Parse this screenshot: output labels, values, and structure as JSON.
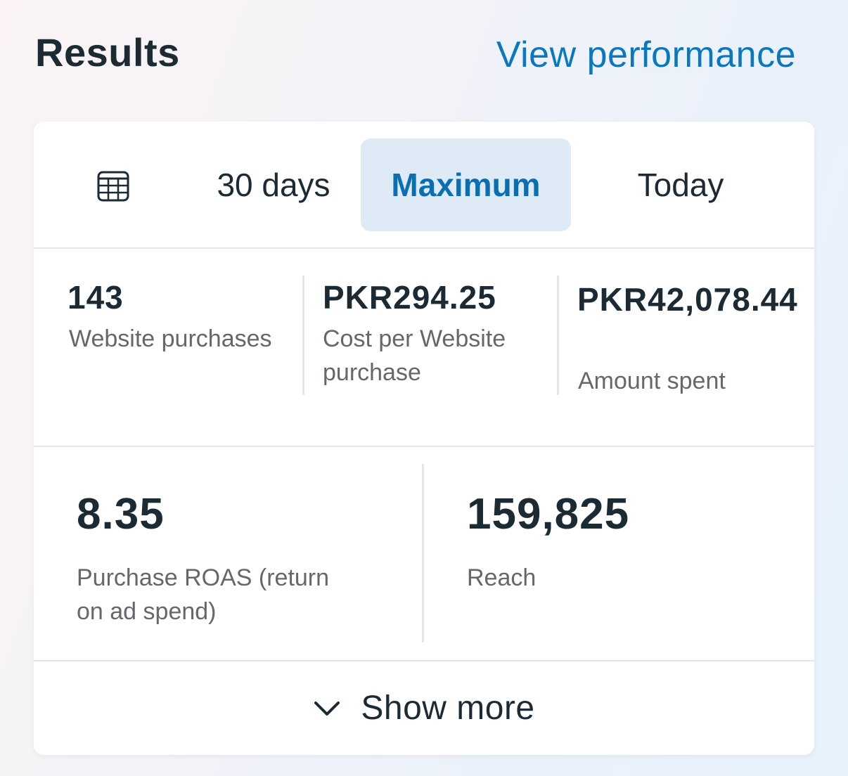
{
  "header": {
    "title": "Results",
    "link_label": "View performance"
  },
  "tabs": {
    "calendar_icon": "calendar-icon",
    "items": [
      {
        "label": "30 days",
        "selected": false
      },
      {
        "label": "Maximum",
        "selected": true
      },
      {
        "label": "Today",
        "selected": false
      }
    ]
  },
  "metrics": {
    "row1": [
      {
        "value": "143",
        "label": "Website purchases"
      },
      {
        "value": "PKR294.25",
        "label": "Cost per Website purchase"
      },
      {
        "value": "PKR42,078.44",
        "label": "Amount spent"
      }
    ],
    "row2": [
      {
        "value": "8.35",
        "label": "Purchase ROAS (return on ad spend)"
      },
      {
        "value": "159,825",
        "label": "Reach"
      }
    ]
  },
  "footer": {
    "show_more_label": "Show more",
    "icon": "chevron-down-icon"
  },
  "colors": {
    "accent": "#0a78be",
    "selected_tab_bg": "#dfeaf7",
    "text_primary": "#1c2b33",
    "text_secondary": "#65676b"
  }
}
